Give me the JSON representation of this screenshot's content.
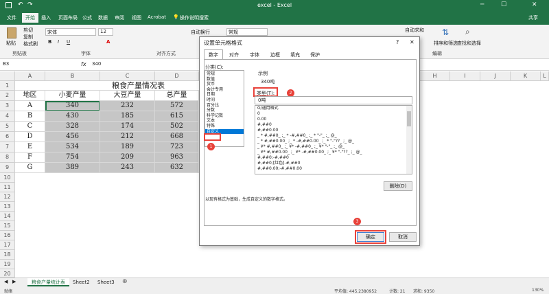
{
  "title": "excel - Excel",
  "menu": [
    "文件",
    "开始",
    "插入",
    "页面布局",
    "公式",
    "数据",
    "审阅",
    "视图",
    "Acrobat"
  ],
  "tell_me": "操作说明搜索",
  "share": "共享",
  "ribbon": {
    "paste": "粘贴",
    "cut": "剪切",
    "copy": "复制",
    "format_painter": "格式刷",
    "clipboard": "剪贴板",
    "font_name": "宋体",
    "font_size": "12",
    "font_group": "字体",
    "wrap": "自动换行",
    "align_group": "对齐方式",
    "number_format": "常规",
    "autosum": "自动求和",
    "sort_filter": "排序和筛选",
    "find_select": "查找和选择",
    "edit_group": "编辑"
  },
  "formula": {
    "namebox": "B3",
    "fx": "fx",
    "value": "340"
  },
  "columns": [
    "A",
    "B",
    "C",
    "D",
    "E",
    "F",
    "G",
    "H",
    "I",
    "J",
    "K",
    "L"
  ],
  "rows": [
    "1",
    "2",
    "3",
    "4",
    "5",
    "6",
    "7",
    "8",
    "9",
    "10",
    "11",
    "12",
    "13",
    "14",
    "15",
    "16",
    "17",
    "18",
    "19",
    "20",
    "21",
    "22"
  ],
  "table": {
    "title": "粮食产量情况表",
    "headers": [
      "地区",
      "小麦产量",
      "大豆产量",
      "总产量"
    ],
    "data": [
      [
        "A",
        "340",
        "232",
        "572"
      ],
      [
        "B",
        "430",
        "185",
        "615"
      ],
      [
        "C",
        "328",
        "174",
        "502"
      ],
      [
        "D",
        "456",
        "212",
        "668"
      ],
      [
        "E",
        "534",
        "189",
        "723"
      ],
      [
        "F",
        "754",
        "209",
        "963"
      ],
      [
        "G",
        "389",
        "243",
        "632"
      ]
    ]
  },
  "sheets": [
    "粮食产量统计表",
    "Sheet2",
    "Sheet3"
  ],
  "status": {
    "left": "就绪",
    "avg": "平均值: 445.2380952",
    "count": "计数: 21",
    "sum": "求和: 9350",
    "zoom": "130%"
  },
  "dialog": {
    "title": "设置单元格格式",
    "tabs": [
      "数字",
      "对齐",
      "字体",
      "边框",
      "填充",
      "保护"
    ],
    "category_label": "分类(C):",
    "categories": [
      "常规",
      "数值",
      "货币",
      "会计专用",
      "日期",
      "时间",
      "百分比",
      "分数",
      "科学记数",
      "文本",
      "特殊",
      "自定义"
    ],
    "sample_label": "示例",
    "sample_value": "340吨",
    "type_label": "类型(T):",
    "type_value": "0吨",
    "formats": [
      "G/通用格式",
      "0",
      "0.00",
      "#,##0",
      "#,##0.00",
      "_ * #,##0_ ;_ * -#,##0_ ;_ * \"-\"_ ;_ @_",
      "_ * #,##0.00_ ;_ * -#,##0.00_ ;_ * \"-\"??_ ;_ @_",
      "_ ¥* #,##0_ ;_ ¥* -#,##0_ ;_ ¥* \"-\"_ ;_ @_",
      "_ ¥* #,##0.00_ ;_ ¥* -#,##0.00_ ;_ ¥* \"-\"??_ ;_ @_",
      "#,##0;-#,##0",
      "#,##0;[红色]-#,##0",
      "#,##0.00;-#,##0.00"
    ],
    "delete": "删除(D)",
    "description": "以现有格式为基础，生成自定义的数字格式。",
    "ok": "确定",
    "cancel": "取消",
    "steps": [
      "1",
      "2",
      "3"
    ]
  },
  "colors": {
    "excel_green": "#217346",
    "selection": "#c6c6c6",
    "marker": "#e8423a"
  }
}
